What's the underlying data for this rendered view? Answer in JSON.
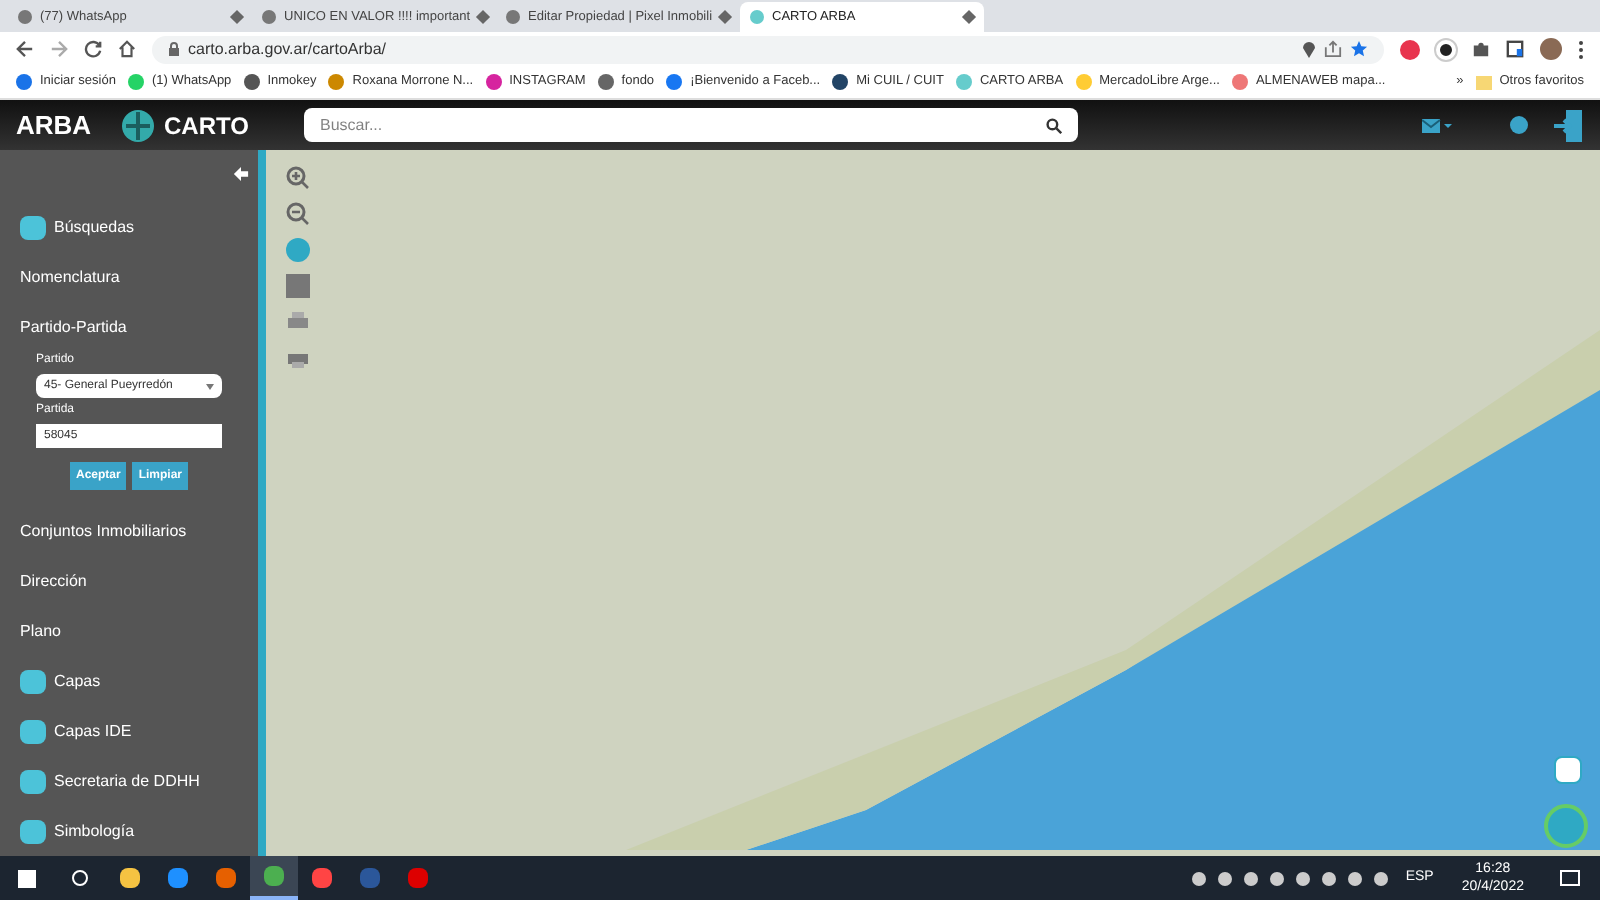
{
  "tabs": [
    {
      "title": "(77) WhatsApp",
      "selected": false
    },
    {
      "title": "UNICO EN VALOR !!!! important",
      "selected": false
    },
    {
      "title": "Editar Propiedad | Pixel Inmobili",
      "selected": false
    },
    {
      "title": "CARTO ARBA",
      "selected": true
    }
  ],
  "address": "carto.arba.gov.ar/cartoArba/",
  "bookmarks": [
    "Iniciar sesión",
    "(1) WhatsApp",
    "Inmokey",
    "Roxana Morrone N...",
    "INSTAGRAM",
    "fondo",
    "¡Bienvenido a Faceb...",
    "Mi CUIL / CUIT",
    "CARTO ARBA",
    "MercadoLibre Arge...",
    "ALMENAWEB mapa..."
  ],
  "bookmarks_more": "»",
  "other_bookmarks": "Otros favoritos",
  "app": {
    "brand": "ARBA",
    "logo_text": "CARTO",
    "search_placeholder": "Buscar..."
  },
  "sidebar": {
    "items": [
      {
        "kind": "icon",
        "label": "Búsquedas"
      },
      {
        "kind": "plain",
        "label": "Nomenclatura"
      },
      {
        "kind": "plain",
        "label": "Partido-Partida"
      }
    ],
    "form": {
      "partido_label": "Partido",
      "partido_value": "45- General Pueyrredón",
      "partida_label": "Partida",
      "partida_value": "58045",
      "buttons": [
        "Aceptar",
        "Limpiar"
      ]
    },
    "items_after": [
      {
        "kind": "plain",
        "label": "Conjuntos Inmobiliarios"
      },
      {
        "kind": "plain",
        "label": "Dirección"
      },
      {
        "kind": "plain",
        "label": "Plano"
      },
      {
        "kind": "icon",
        "label": "Capas"
      },
      {
        "kind": "icon",
        "label": "Capas IDE"
      },
      {
        "kind": "icon",
        "label": "Secretaria de DDHH"
      },
      {
        "kind": "icon",
        "label": "Simbología"
      }
    ]
  },
  "taskbar": {
    "apps": [
      {
        "selected": false
      },
      {
        "selected": false
      },
      {
        "selected": false
      },
      {
        "selected": true
      },
      {
        "selected": false
      },
      {
        "selected": false
      },
      {
        "selected": false
      }
    ],
    "language": "ESP",
    "time": "16:28",
    "date": "20/4/2022"
  }
}
